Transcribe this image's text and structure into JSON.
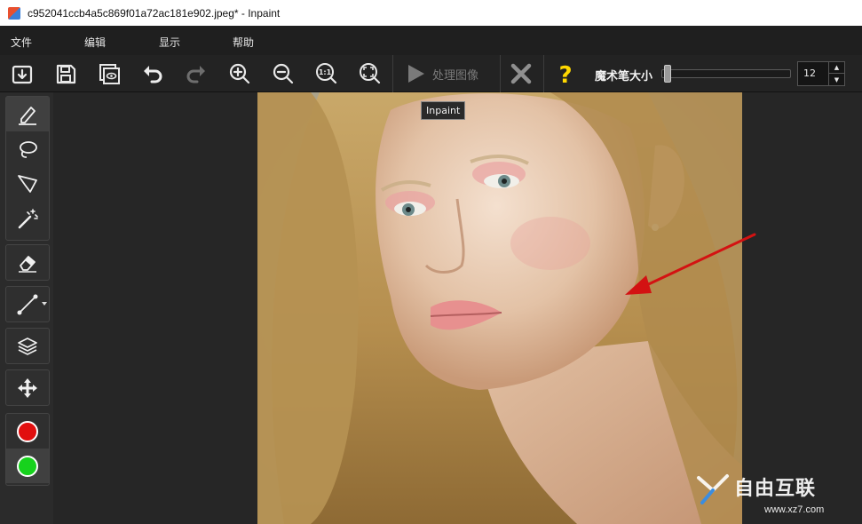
{
  "window": {
    "title": "c952041ccb4a5c869f01a72ac181e902.jpeg* - Inpaint"
  },
  "menu": {
    "items": [
      {
        "label": "文件"
      },
      {
        "label": "编辑"
      },
      {
        "label": "显示"
      },
      {
        "label": "帮助"
      }
    ]
  },
  "toolbar": {
    "buttons": [
      {
        "name": "open-icon"
      },
      {
        "name": "save-icon"
      },
      {
        "name": "preview-icon"
      },
      {
        "name": "undo-icon"
      },
      {
        "name": "redo-icon"
      },
      {
        "name": "zoom-in-icon"
      },
      {
        "name": "zoom-out-icon"
      },
      {
        "name": "zoom-actual-size-icon",
        "text": "1:1"
      },
      {
        "name": "fit-to-window-icon"
      }
    ],
    "process_label": "处理图像",
    "brush_size_label": "魔术笔大小",
    "brush_size_value": "12",
    "brush_size_level": 0.02
  },
  "tooltip": {
    "text": "Inpaint"
  },
  "sidebar": {
    "tools": [
      {
        "name": "marker-icon",
        "active": true
      },
      {
        "name": "lasso-icon"
      },
      {
        "name": "polygonal-lasso-icon"
      },
      {
        "name": "magic-wand-icon"
      },
      {
        "name": "eraser-icon"
      },
      {
        "name": "guide-line-icon"
      },
      {
        "name": "layers-icon"
      },
      {
        "name": "move-icon"
      }
    ],
    "colors": [
      {
        "name": "red-color",
        "hex": "#e10f0f"
      },
      {
        "name": "green-color",
        "hex": "#17d21d"
      }
    ]
  },
  "watermark": {
    "title": "自由互联",
    "url": "www.xz7.com"
  },
  "colors": {
    "accent_yellow": "#ffd800",
    "cancel_gray": "#8f8f8f",
    "annotation_arrow": "#d31212"
  }
}
